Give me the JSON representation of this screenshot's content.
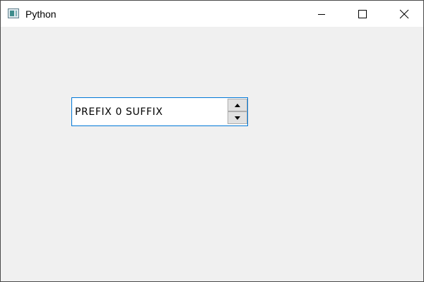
{
  "window": {
    "title": "Python",
    "icon": "python-app-icon",
    "controls": {
      "minimize_icon": "minimize-icon",
      "maximize_icon": "maximize-icon",
      "close_icon": "close-icon"
    }
  },
  "spinbox": {
    "prefix": "PREFIX",
    "value": "0",
    "suffix": "SUFFIX",
    "display_text": "PREFIX 0 SUFFIX",
    "up_icon": "arrow-up-icon",
    "down_icon": "arrow-down-icon"
  },
  "colors": {
    "focus_border": "#0078d7",
    "window_bg": "#f0f0f0",
    "titlebar_bg": "#ffffff"
  }
}
